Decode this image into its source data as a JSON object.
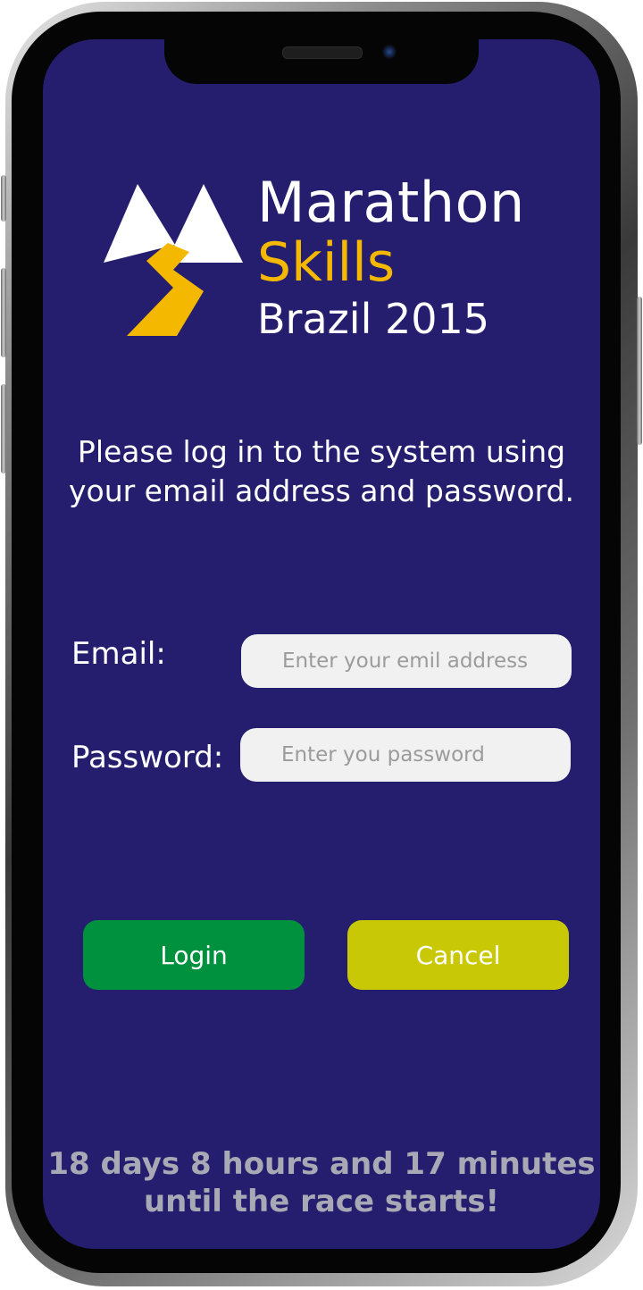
{
  "logo": {
    "line1": "Marathon",
    "line2": "Skills",
    "line3": "Brazil 2015"
  },
  "intro": {
    "line1": "Please log in to the system using",
    "line2": "your email address and password."
  },
  "form": {
    "email_label": "Email:",
    "email_placeholder": "Enter your emil address",
    "email_value": "",
    "password_label": "Password:",
    "password_placeholder": "Enter you password",
    "password_value": ""
  },
  "buttons": {
    "login_label": "Login",
    "cancel_label": "Cancel"
  },
  "countdown": {
    "line1": "18 days 8 hours and 17 minutes",
    "line2": "until the race starts!"
  },
  "colors": {
    "background": "#251e6e",
    "accent_yellow": "#f5b800",
    "login_green": "#00913f",
    "cancel_olive": "#c9c807",
    "countdown_gray": "#a9a9b6"
  },
  "icons": {
    "logo_mark": "mountain-lightning-icon"
  }
}
